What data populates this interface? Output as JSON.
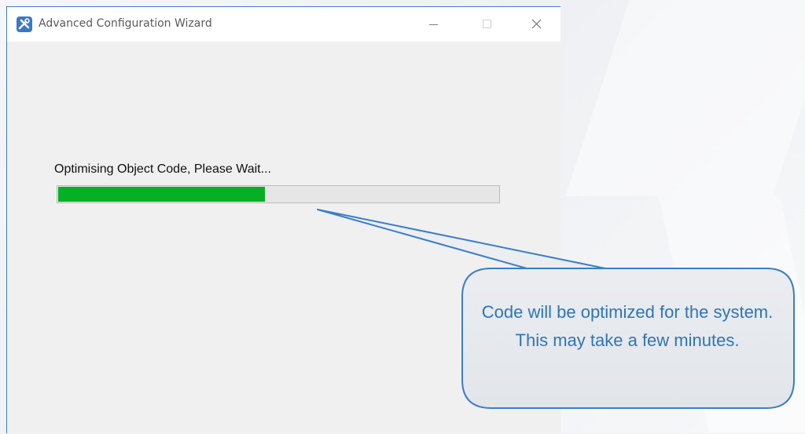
{
  "window": {
    "title": "Advanced Configuration Wizard",
    "icon": "wizard-tools-icon",
    "controls": {
      "minimize_icon": "minimize-icon",
      "maximize_icon": "maximize-icon",
      "close_icon": "close-icon"
    }
  },
  "progress": {
    "label": "Optimising Object Code, Please Wait...",
    "fraction": 0.47,
    "fill_color": "#06b025",
    "track_color": "#e6e6e6"
  },
  "callout": {
    "text": "Code will be optimized for the system. This may take a few minutes.",
    "text_color": "#2e75b6",
    "border_color": "#3a7ec8"
  },
  "colors": {
    "window_border": "#3a7ec8",
    "window_background": "#f0f0f0",
    "titlebar_background": "#ffffff"
  }
}
